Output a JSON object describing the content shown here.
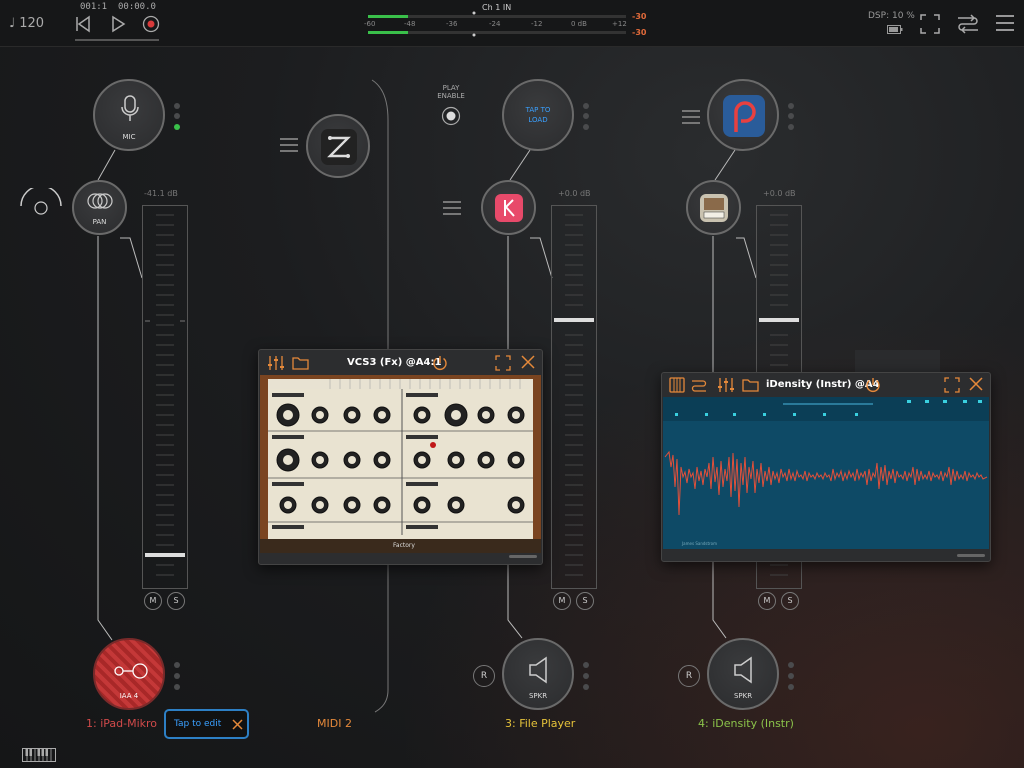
{
  "transport": {
    "tempo": "♩ 120",
    "bar_position": "001:1",
    "time": "00:00.0"
  },
  "input_meter": {
    "label": "Ch 1 IN",
    "scale": [
      "-60",
      "-48",
      "-36",
      "-24",
      "-12",
      "0 dB",
      "+12"
    ],
    "peak_top": "-30",
    "peak_bottom": "-30"
  },
  "status": {
    "dsp": "DSP: 10 %"
  },
  "channels": [
    {
      "source_label": "MIC",
      "pan_label": "PAN",
      "volume": "-41.1 dB",
      "mute": "M",
      "solo": "S",
      "output_label": "IAA 4",
      "name": "1: iPad-Mikro",
      "name_color": "#d04a4a"
    },
    {
      "name": "MIDI 2",
      "name_color": "#e5893a"
    },
    {
      "play_enable": "PLAY ENABLE",
      "source_label": "TAP TO LOAD",
      "volume": "+0.0 dB",
      "mute": "M",
      "solo": "S",
      "record": "R",
      "output_label": "SPKR",
      "name": "3: File Player",
      "name_color": "#e5c23a"
    },
    {
      "volume": "+0.0 dB",
      "mute": "M",
      "solo": "S",
      "record": "R",
      "output_label": "SPKR",
      "name": "4: iDensity (Instr)",
      "name_color": "#8bc34a"
    }
  ],
  "plugin_vcs3": {
    "title": "VCS3 (Fx) @A4:1",
    "preset": "Factory"
  },
  "plugin_idensity": {
    "title": "iDensity (Instr) @A4",
    "footer": "James Sandstrom"
  },
  "tooltip": {
    "text": "Tap to edit"
  },
  "colors": {
    "accent_orange": "#e5893a",
    "accent_blue": "#3aa0ff",
    "record_red": "#d83a3a",
    "meter_green": "#3ac04a"
  }
}
